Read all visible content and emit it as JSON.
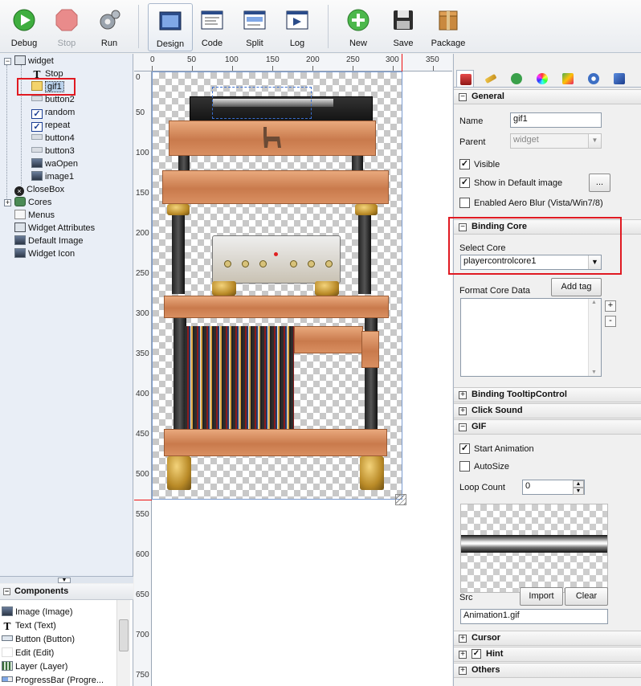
{
  "toolbar": {
    "buttons": [
      {
        "label": "Debug"
      },
      {
        "label": "Stop"
      },
      {
        "label": "Run"
      },
      {
        "label": "Design"
      },
      {
        "label": "Code"
      },
      {
        "label": "Split"
      },
      {
        "label": "Log"
      },
      {
        "label": "New"
      },
      {
        "label": "Save"
      },
      {
        "label": "Package"
      }
    ]
  },
  "tree": {
    "root": "widget",
    "items": [
      "Stop",
      "gif1",
      "button2",
      "random",
      "repeat",
      "button4",
      "button3",
      "waOpen",
      "image1",
      "CloseBox",
      "Cores",
      "Menus",
      "Widget Attributes",
      "Default Image",
      "Widget Icon"
    ]
  },
  "components": {
    "title": "Components",
    "items": [
      "Image (Image)",
      "Text (Text)",
      "Button (Button)",
      "Edit (Edit)",
      "Layer (Layer)",
      "ProgressBar (Progre..."
    ]
  },
  "ruler": {
    "top": [
      "0",
      "50",
      "100",
      "150",
      "200",
      "250",
      "300",
      "350"
    ],
    "left": [
      "0",
      "50",
      "100",
      "150",
      "200",
      "250",
      "300",
      "350",
      "400",
      "450",
      "500",
      "550",
      "600",
      "650",
      "700",
      "750"
    ]
  },
  "props": {
    "general": {
      "title": "General",
      "name_label": "Name",
      "name_value": "gif1",
      "parent_label": "Parent",
      "parent_value": "widget",
      "visible_label": "Visible",
      "show_default_label": "Show in Default image",
      "ellipsis": "...",
      "aero_label": "Enabled Aero Blur (Vista/Win7/8)"
    },
    "binding": {
      "title": "Binding Core",
      "select_label": "Select Core",
      "select_value": "playercontrolcore1",
      "format_label": "Format Core Data",
      "add_tag": "Add tag",
      "plus": "+",
      "minus": "-"
    },
    "tooltip": {
      "title": "Binding TooltipControl"
    },
    "click_sound": {
      "title": "Click Sound"
    },
    "gif": {
      "title": "GIF",
      "start_label": "Start Animation",
      "autosize_label": "AutoSize",
      "loop_label": "Loop Count",
      "loop_value": "0",
      "src_label": "Src",
      "import": "Import",
      "clear": "Clear",
      "src_value": "Animation1.gif"
    },
    "cursor": {
      "title": "Cursor"
    },
    "hint": {
      "title": "Hint"
    },
    "others": {
      "title": "Others"
    }
  }
}
